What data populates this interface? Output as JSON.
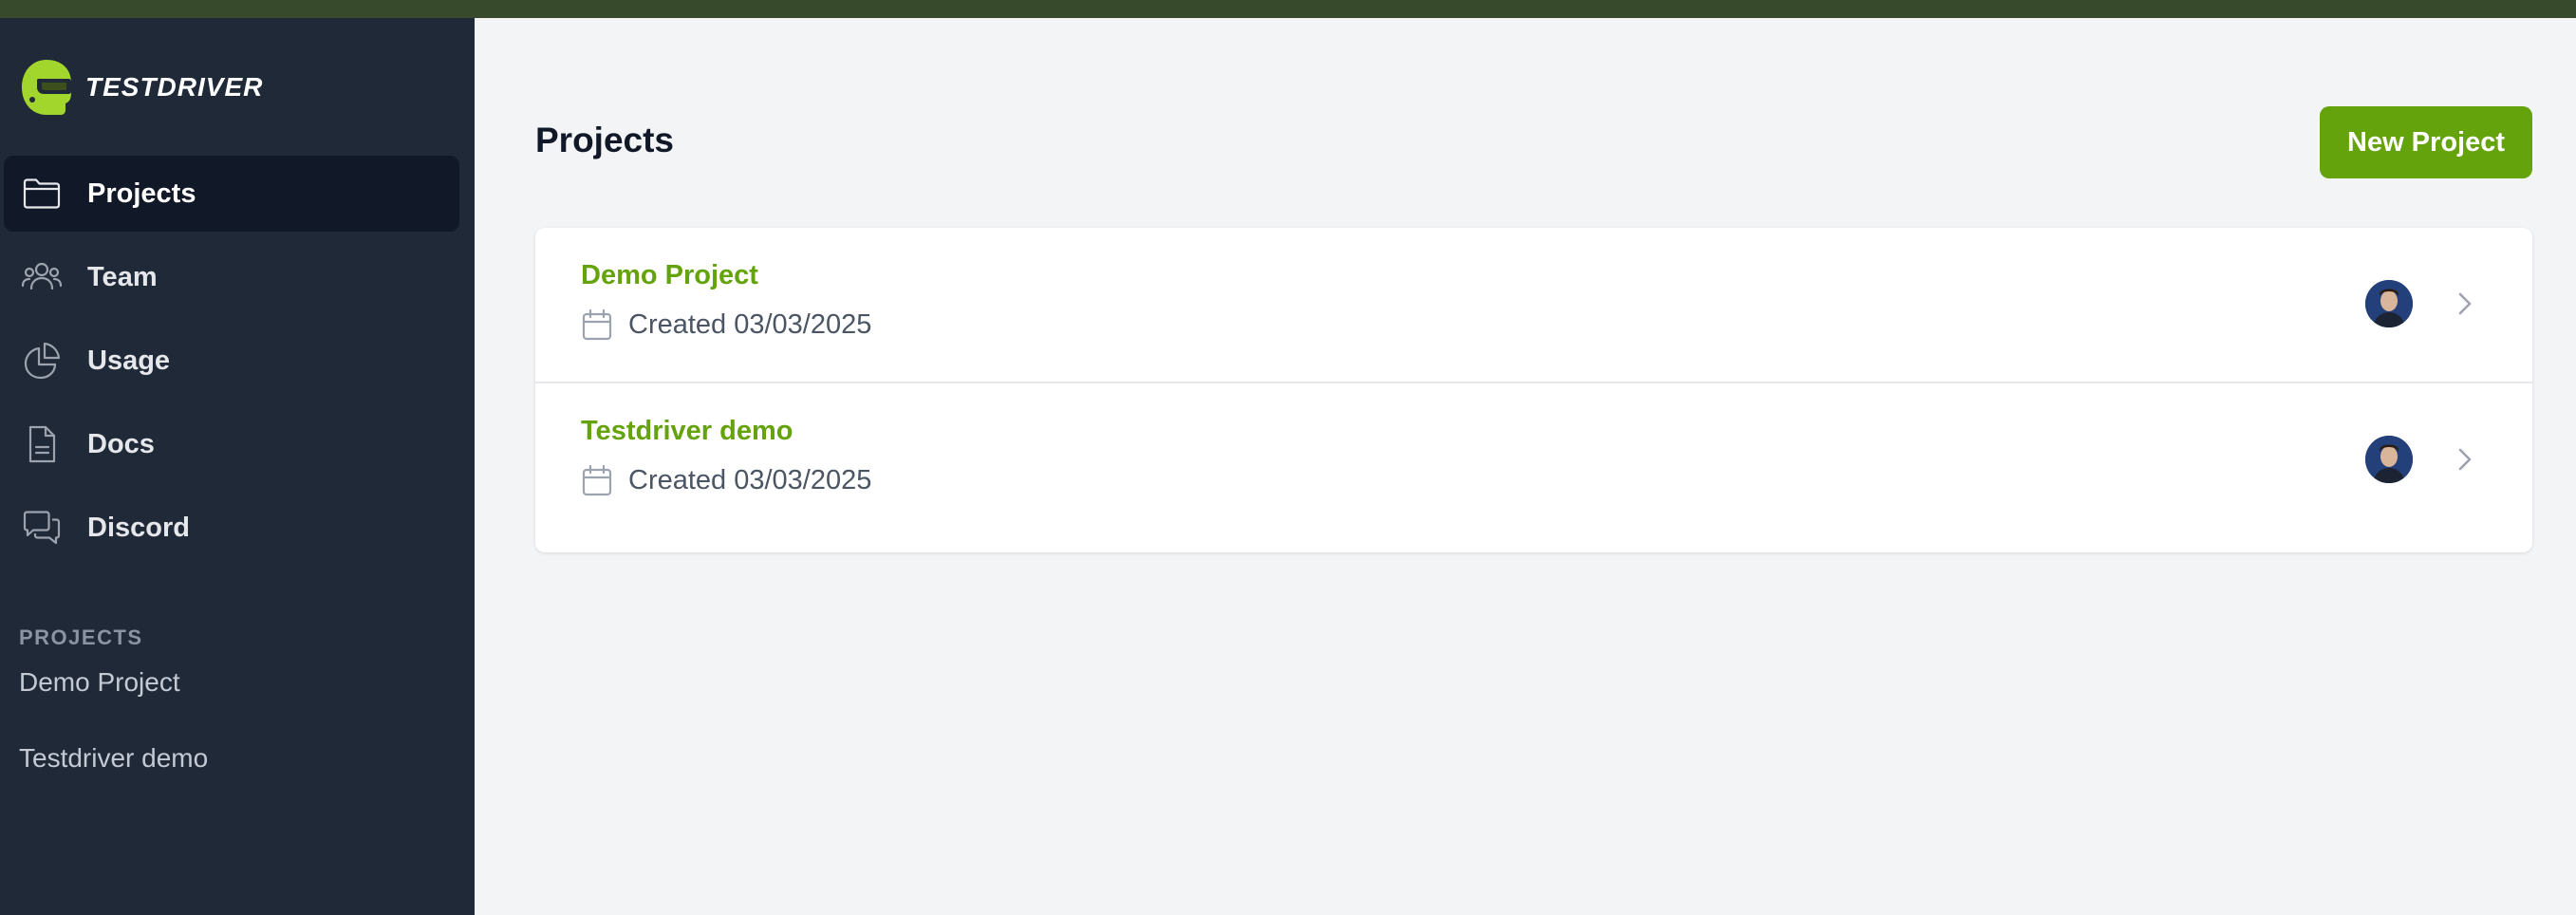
{
  "brand": {
    "name": "TESTDRIVER",
    "logo_icon": "helmet-icon",
    "accent": "#a3d62d"
  },
  "sidebar": {
    "nav": [
      {
        "label": "Projects",
        "icon": "folder-icon",
        "active": true
      },
      {
        "label": "Team",
        "icon": "users-icon",
        "active": false
      },
      {
        "label": "Usage",
        "icon": "chart-pie-icon",
        "active": false
      },
      {
        "label": "Docs",
        "icon": "document-icon",
        "active": false
      },
      {
        "label": "Discord",
        "icon": "chat-icon",
        "active": false
      }
    ],
    "section_label": "PROJECTS",
    "projects": [
      "Demo Project",
      "Testdriver demo"
    ]
  },
  "main": {
    "title": "Projects",
    "new_button": "New Project",
    "rows": [
      {
        "name": "Demo Project",
        "created": "Created 03/03/2025"
      },
      {
        "name": "Testdriver demo",
        "created": "Created 03/03/2025"
      }
    ]
  },
  "colors": {
    "sidebar_bg": "#1f2937",
    "active_bg": "#111827",
    "accent_green": "#65a30d",
    "page_bg": "#f3f4f6",
    "top_bar": "#374a2c"
  }
}
